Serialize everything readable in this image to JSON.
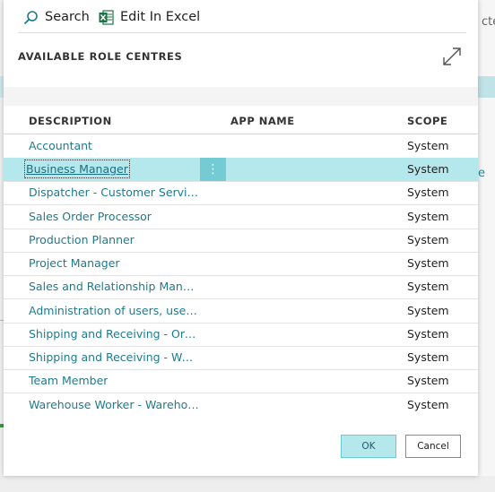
{
  "background": {
    "right_fragment_top": "cter",
    "right_fragment_mid": "e"
  },
  "toolbar": {
    "search_label": "Search",
    "excel_label": "Edit In Excel"
  },
  "dialog": {
    "title": "AVAILABLE ROLE CENTRES"
  },
  "table": {
    "headers": {
      "description": "DESCRIPTION",
      "app_name": "APP NAME",
      "scope": "SCOPE"
    },
    "rows": [
      {
        "description": "Accountant",
        "app_name": "",
        "scope": "System"
      },
      {
        "description": "Business Manager",
        "app_name": "",
        "scope": "System",
        "selected": true
      },
      {
        "description": "Dispatcher - Customer Service",
        "app_name": "",
        "scope": "System"
      },
      {
        "description": "Sales Order Processor",
        "app_name": "",
        "scope": "System"
      },
      {
        "description": "Production Planner",
        "app_name": "",
        "scope": "System"
      },
      {
        "description": "Project Manager",
        "app_name": "",
        "scope": "System"
      },
      {
        "description": "Sales and Relationship Manager",
        "app_name": "",
        "scope": "System"
      },
      {
        "description": "Administration of users, user g...",
        "app_name": "",
        "scope": "System"
      },
      {
        "description": "Shipping and Receiving - Orde...",
        "app_name": "",
        "scope": "System"
      },
      {
        "description": "Shipping and Receiving - Ware...",
        "app_name": "",
        "scope": "System"
      },
      {
        "description": "Team Member",
        "app_name": "",
        "scope": "System"
      },
      {
        "description": "Warehouse Worker - Warehou...",
        "app_name": "",
        "scope": "System"
      }
    ]
  },
  "footer": {
    "ok_label": "OK",
    "cancel_label": "Cancel"
  },
  "colors": {
    "accent": "#1f7a8c",
    "selected_row": "#b4e8ec",
    "kebab": "#75cbd3",
    "excel_green": "#1e7145"
  },
  "icons": {
    "search": "search-icon",
    "excel": "excel-icon",
    "expand": "expand-icon",
    "row_menu": "more-vertical-icon"
  }
}
